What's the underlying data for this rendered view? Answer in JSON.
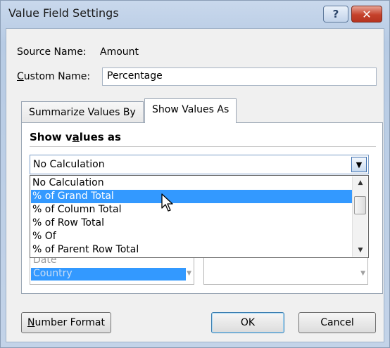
{
  "window": {
    "title": "Value Field Settings",
    "help_glyph": "?",
    "close_glyph": "✕"
  },
  "source": {
    "label": "Source Name:",
    "value": "Amount"
  },
  "custom_name": {
    "label_accel": "C",
    "label_rest": "ustom Name:",
    "value": "Percentage"
  },
  "tabs": [
    {
      "label": "Summarize Values By",
      "active": false
    },
    {
      "label": "Show Values As",
      "active": true
    }
  ],
  "section": {
    "head_pre": "Show v",
    "head_accel": "a",
    "head_post": "lues as"
  },
  "combo": {
    "value": "No Calculation"
  },
  "dropdown": {
    "options": [
      {
        "label": "No Calculation",
        "selected": false
      },
      {
        "label": "% of Grand Total",
        "selected": true
      },
      {
        "label": "% of Column Total",
        "selected": false
      },
      {
        "label": "% of Row Total",
        "selected": false
      },
      {
        "label": "% Of",
        "selected": false
      },
      {
        "label": "% of Parent Row Total",
        "selected": false
      }
    ]
  },
  "base_field": {
    "items": [
      {
        "label": "Date",
        "selected": false
      },
      {
        "label": "Country",
        "selected": true
      }
    ]
  },
  "buttons": {
    "number_format_accel": "N",
    "number_format_rest": "umber Format",
    "ok": "OK",
    "cancel": "Cancel"
  },
  "colors": {
    "selection": "#3399ff",
    "close_button": "#c5412b"
  }
}
